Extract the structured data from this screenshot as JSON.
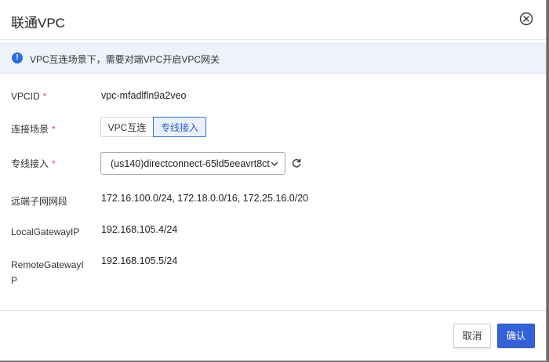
{
  "dialog": {
    "title": "联通VPC",
    "close_icon": "close-circle-icon"
  },
  "notice": {
    "icon": "info-icon",
    "icon_glyph": "!",
    "text": "VPC互连场景下，需要对端VPC开启VPC网关"
  },
  "form": {
    "required_mark": "*",
    "vpcid": {
      "label": "VPCID",
      "value": "vpc-mfadlfln9a2veo"
    },
    "scenario": {
      "label": "连接场景",
      "options": [
        "VPC互连",
        "专线接入"
      ],
      "selected": "专线接入"
    },
    "direct_connect": {
      "label": "专线接入",
      "selected": "(us140)directconnect-65ld5eeavrt8ct"
    },
    "remote_subnets": {
      "label": "远端子网网段",
      "value": "172.16.100.0/24, 172.18.0.0/16, 172.25.16.0/20"
    },
    "local_gateway_ip": {
      "label": "LocalGatewayIP",
      "value": "192.168.105.4/24"
    },
    "remote_gateway_ip": {
      "label_line1": "RemoteGatewayI",
      "label_line2": "P",
      "value": "192.168.105.5/24"
    }
  },
  "footer": {
    "cancel_label": "取消",
    "confirm_label": "确认"
  },
  "colors": {
    "primary": "#3461d6",
    "required": "#e5484d",
    "notice_bg": "#eef2fb"
  }
}
